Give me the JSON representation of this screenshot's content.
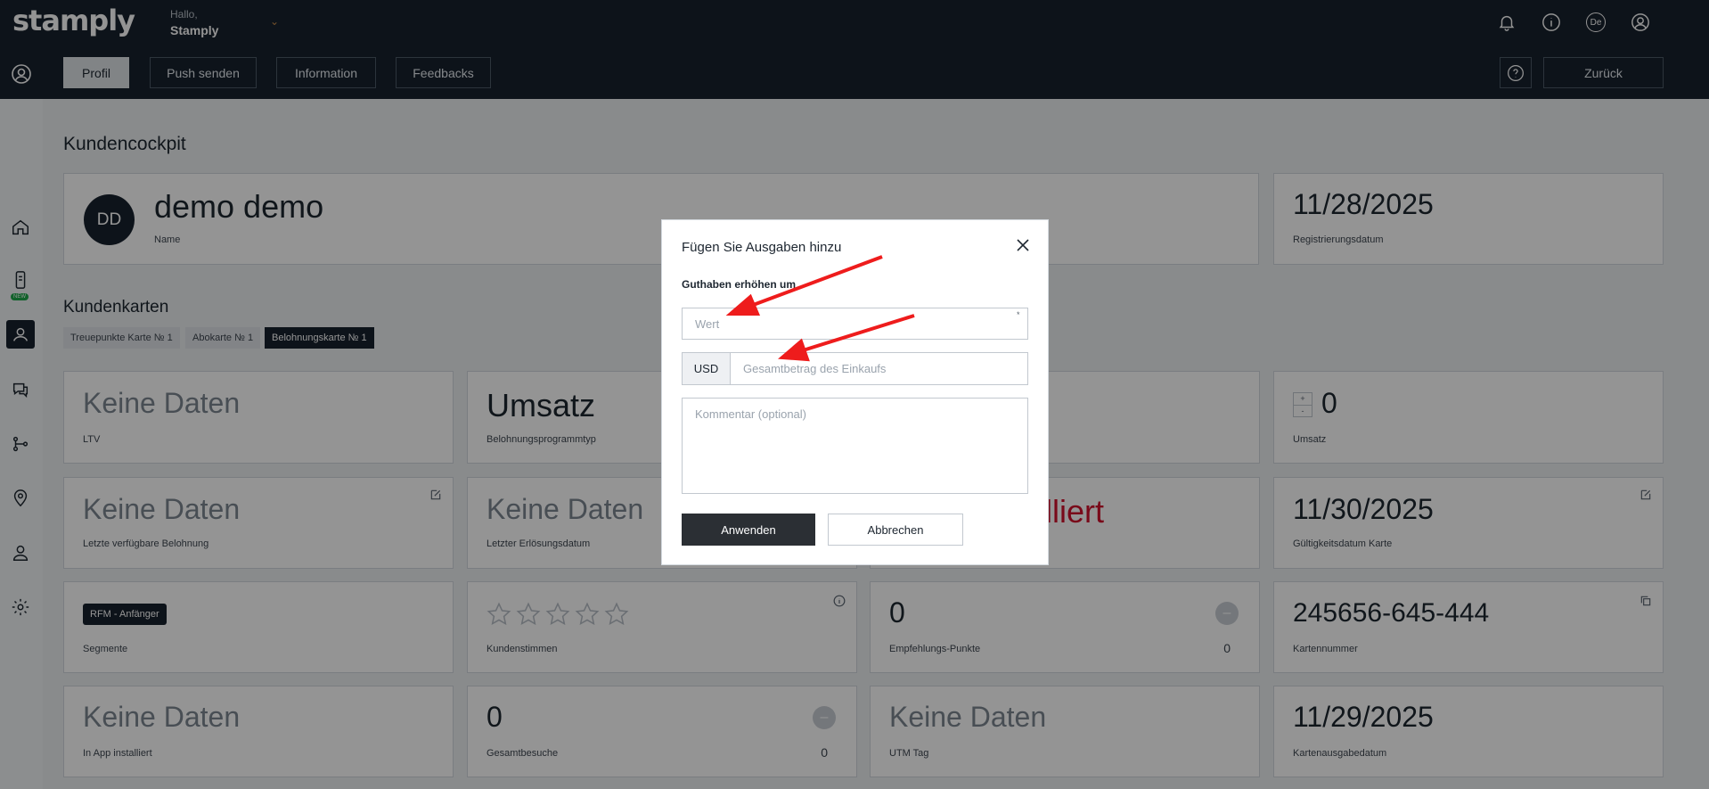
{
  "header": {
    "logo": "stamply",
    "greeting": "Hallo,",
    "username": "Stamply",
    "lang": "De"
  },
  "nav": {
    "tabs": [
      "Profil",
      "Push senden",
      "Information",
      "Feedbacks"
    ],
    "help": "?",
    "back": "Zurück"
  },
  "sidebar": {
    "new_badge": "NEW"
  },
  "page": {
    "title": "Kundencockpit",
    "customer": {
      "initials": "DD",
      "name": "demo demo",
      "name_label": "Name",
      "reg_date": "11/28/2025",
      "reg_label": "Registrierungsdatum"
    },
    "cards_title": "Kundenkarten",
    "chips": [
      "Treuepunkte Karte № 1",
      "Abokarte № 1",
      "Belohnungskarte № 1"
    ],
    "row1": {
      "ltv_value": "Keine Daten",
      "ltv_label": "LTV",
      "type_value": "Umsatz",
      "type_label": "Belohnungsprogrammtyp",
      "umsatz_value": "0",
      "umsatz_label": "Umsatz"
    },
    "row2": {
      "reward_value": "Keine Daten",
      "reward_label": "Letzte verfügbare Belohnung",
      "redeem_value": "Keine Daten",
      "redeem_label": "Letzter Erlösungsdatum",
      "install_value": "lliert",
      "valid_value": "11/30/2025",
      "valid_label": "Gültigkeitsdatum Karte"
    },
    "row3": {
      "segment_badge": "RFM - Anfänger",
      "segment_label": "Segmente",
      "voices_label": "Kundenstimmen",
      "referral_value": "0",
      "referral_right": "0",
      "referral_label": "Empfehlungs-Punkte",
      "cardnum_value": "245656-645-444",
      "cardnum_label": "Kartennummer"
    },
    "row4": {
      "app_value": "Keine Daten",
      "app_label": "In App installiert",
      "visits_value": "0",
      "visits_right": "0",
      "visits_label": "Gesamtbesuche",
      "utm_value": "Keine Daten",
      "utm_label": "UTM Tag",
      "issue_value": "11/29/2025",
      "issue_label": "Kartenausgabedatum"
    }
  },
  "modal": {
    "title": "Fügen Sie Ausgaben hinzu",
    "label": "Guthaben erhöhen um",
    "value_placeholder": "Wert",
    "required_mark": "*",
    "currency": "USD",
    "total_placeholder": "Gesamtbetrag des Einkaufs",
    "comment_placeholder": "Kommentar (optional)",
    "apply": "Anwenden",
    "cancel": "Abbrechen"
  },
  "colors": {
    "header_bg": "#18222d",
    "annotation_arrow": "#ee1c1c",
    "installed_text": "#d0102c"
  }
}
